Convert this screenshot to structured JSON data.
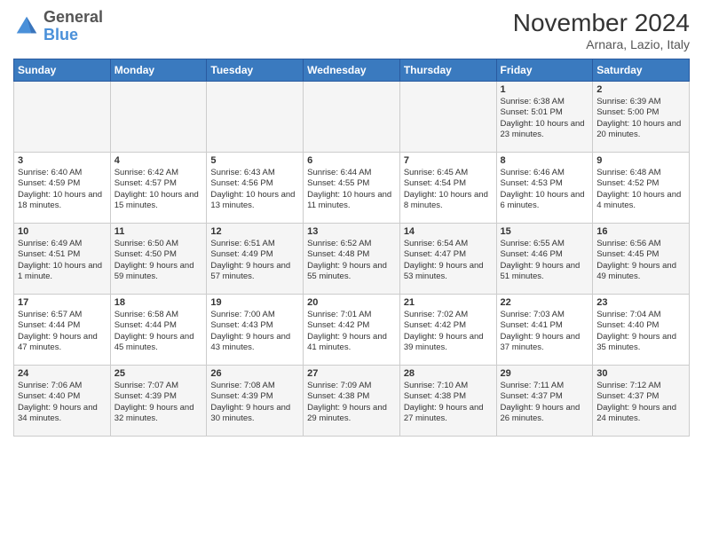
{
  "logo": {
    "line1": "General",
    "line2": "Blue"
  },
  "title": "November 2024",
  "location": "Arnara, Lazio, Italy",
  "days_of_week": [
    "Sunday",
    "Monday",
    "Tuesday",
    "Wednesday",
    "Thursday",
    "Friday",
    "Saturday"
  ],
  "weeks": [
    [
      {
        "day": "",
        "info": ""
      },
      {
        "day": "",
        "info": ""
      },
      {
        "day": "",
        "info": ""
      },
      {
        "day": "",
        "info": ""
      },
      {
        "day": "",
        "info": ""
      },
      {
        "day": "1",
        "info": "Sunrise: 6:38 AM\nSunset: 5:01 PM\nDaylight: 10 hours and 23 minutes."
      },
      {
        "day": "2",
        "info": "Sunrise: 6:39 AM\nSunset: 5:00 PM\nDaylight: 10 hours and 20 minutes."
      }
    ],
    [
      {
        "day": "3",
        "info": "Sunrise: 6:40 AM\nSunset: 4:59 PM\nDaylight: 10 hours and 18 minutes."
      },
      {
        "day": "4",
        "info": "Sunrise: 6:42 AM\nSunset: 4:57 PM\nDaylight: 10 hours and 15 minutes."
      },
      {
        "day": "5",
        "info": "Sunrise: 6:43 AM\nSunset: 4:56 PM\nDaylight: 10 hours and 13 minutes."
      },
      {
        "day": "6",
        "info": "Sunrise: 6:44 AM\nSunset: 4:55 PM\nDaylight: 10 hours and 11 minutes."
      },
      {
        "day": "7",
        "info": "Sunrise: 6:45 AM\nSunset: 4:54 PM\nDaylight: 10 hours and 8 minutes."
      },
      {
        "day": "8",
        "info": "Sunrise: 6:46 AM\nSunset: 4:53 PM\nDaylight: 10 hours and 6 minutes."
      },
      {
        "day": "9",
        "info": "Sunrise: 6:48 AM\nSunset: 4:52 PM\nDaylight: 10 hours and 4 minutes."
      }
    ],
    [
      {
        "day": "10",
        "info": "Sunrise: 6:49 AM\nSunset: 4:51 PM\nDaylight: 10 hours and 1 minute."
      },
      {
        "day": "11",
        "info": "Sunrise: 6:50 AM\nSunset: 4:50 PM\nDaylight: 9 hours and 59 minutes."
      },
      {
        "day": "12",
        "info": "Sunrise: 6:51 AM\nSunset: 4:49 PM\nDaylight: 9 hours and 57 minutes."
      },
      {
        "day": "13",
        "info": "Sunrise: 6:52 AM\nSunset: 4:48 PM\nDaylight: 9 hours and 55 minutes."
      },
      {
        "day": "14",
        "info": "Sunrise: 6:54 AM\nSunset: 4:47 PM\nDaylight: 9 hours and 53 minutes."
      },
      {
        "day": "15",
        "info": "Sunrise: 6:55 AM\nSunset: 4:46 PM\nDaylight: 9 hours and 51 minutes."
      },
      {
        "day": "16",
        "info": "Sunrise: 6:56 AM\nSunset: 4:45 PM\nDaylight: 9 hours and 49 minutes."
      }
    ],
    [
      {
        "day": "17",
        "info": "Sunrise: 6:57 AM\nSunset: 4:44 PM\nDaylight: 9 hours and 47 minutes."
      },
      {
        "day": "18",
        "info": "Sunrise: 6:58 AM\nSunset: 4:44 PM\nDaylight: 9 hours and 45 minutes."
      },
      {
        "day": "19",
        "info": "Sunrise: 7:00 AM\nSunset: 4:43 PM\nDaylight: 9 hours and 43 minutes."
      },
      {
        "day": "20",
        "info": "Sunrise: 7:01 AM\nSunset: 4:42 PM\nDaylight: 9 hours and 41 minutes."
      },
      {
        "day": "21",
        "info": "Sunrise: 7:02 AM\nSunset: 4:42 PM\nDaylight: 9 hours and 39 minutes."
      },
      {
        "day": "22",
        "info": "Sunrise: 7:03 AM\nSunset: 4:41 PM\nDaylight: 9 hours and 37 minutes."
      },
      {
        "day": "23",
        "info": "Sunrise: 7:04 AM\nSunset: 4:40 PM\nDaylight: 9 hours and 35 minutes."
      }
    ],
    [
      {
        "day": "24",
        "info": "Sunrise: 7:06 AM\nSunset: 4:40 PM\nDaylight: 9 hours and 34 minutes."
      },
      {
        "day": "25",
        "info": "Sunrise: 7:07 AM\nSunset: 4:39 PM\nDaylight: 9 hours and 32 minutes."
      },
      {
        "day": "26",
        "info": "Sunrise: 7:08 AM\nSunset: 4:39 PM\nDaylight: 9 hours and 30 minutes."
      },
      {
        "day": "27",
        "info": "Sunrise: 7:09 AM\nSunset: 4:38 PM\nDaylight: 9 hours and 29 minutes."
      },
      {
        "day": "28",
        "info": "Sunrise: 7:10 AM\nSunset: 4:38 PM\nDaylight: 9 hours and 27 minutes."
      },
      {
        "day": "29",
        "info": "Sunrise: 7:11 AM\nSunset: 4:37 PM\nDaylight: 9 hours and 26 minutes."
      },
      {
        "day": "30",
        "info": "Sunrise: 7:12 AM\nSunset: 4:37 PM\nDaylight: 9 hours and 24 minutes."
      }
    ]
  ]
}
